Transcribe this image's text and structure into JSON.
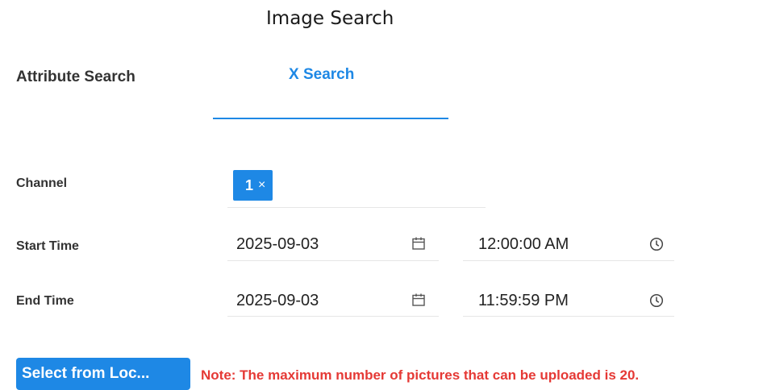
{
  "page": {
    "title": "Image Search"
  },
  "tabs": [
    {
      "label": "Attribute Search",
      "active": false
    },
    {
      "label": "X Search",
      "active": true
    }
  ],
  "form": {
    "channel": {
      "label": "Channel",
      "tags": [
        "1"
      ],
      "remove_glyph": "×"
    },
    "start_time": {
      "label": "Start Time",
      "date": "2025-09-03",
      "time": "12:00:00 AM"
    },
    "end_time": {
      "label": "End Time",
      "date": "2025-09-03",
      "time": "11:59:59 PM"
    }
  },
  "upload": {
    "button_label": "Select from Loc...",
    "note": "Note: The maximum number of pictures that can be uploaded is 20."
  },
  "colors": {
    "accent": "#1e88e5",
    "note": "#e53935"
  },
  "icons": {
    "date": "calendar-icon",
    "time": "clock-icon",
    "remove_tag": "close-icon"
  }
}
